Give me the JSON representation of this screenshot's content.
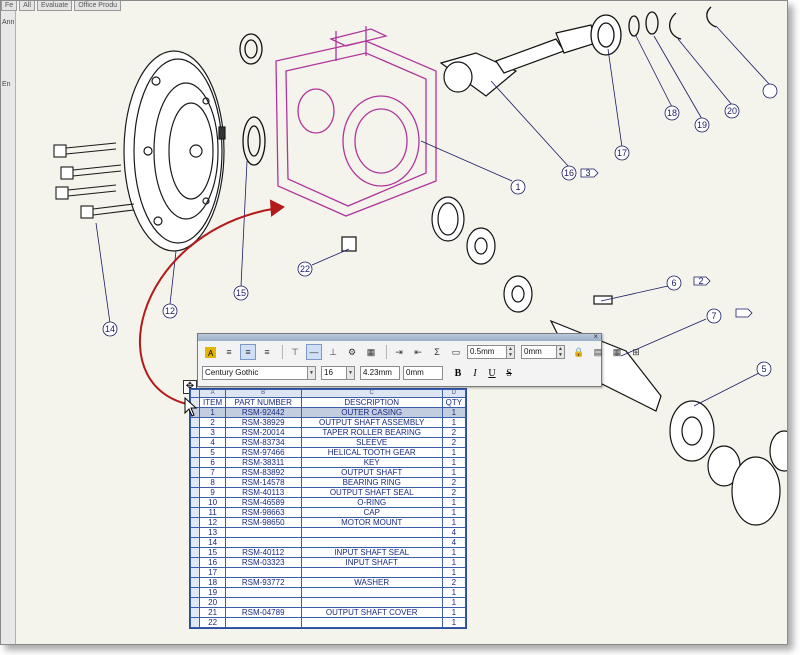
{
  "tabs": [
    "Fe",
    "All",
    "Evaluate",
    "Office Produ"
  ],
  "left_panel": {
    "labels": [
      "Ann",
      "En"
    ]
  },
  "callouts": [
    "1",
    "2",
    "3",
    "5",
    "6",
    "7",
    "12",
    "14",
    "15",
    "16",
    "17",
    "18",
    "19",
    "20",
    "22"
  ],
  "toolbar": {
    "font_name": "Century Gothic",
    "font_size": "16",
    "height_value": "4.23mm",
    "spacing_value": "0mm",
    "margin_value": "0.5mm",
    "margin2_value": "0mm",
    "bold": "B",
    "italic": "I",
    "underline": "U",
    "strike": "S",
    "sum_symbol": "Σ"
  },
  "bom": {
    "col_letters": [
      "A",
      "B",
      "C",
      "D"
    ],
    "headers": [
      "ITEM",
      "PART NUMBER",
      "DESCRIPTION",
      "QTY"
    ],
    "rows": [
      [
        "1",
        "RSM-92442",
        "OUTER CASING",
        "1"
      ],
      [
        "2",
        "RSM-38929",
        "OUTPUT SHAFT ASSEMBLY",
        "1"
      ],
      [
        "3",
        "RSM-20014",
        "TAPER ROLLER BEARING",
        "2"
      ],
      [
        "4",
        "RSM-83734",
        "SLEEVE",
        "2"
      ],
      [
        "5",
        "RSM-97466",
        "HELICAL TOOTH GEAR",
        "1"
      ],
      [
        "6",
        "RSM-38311",
        "KEY",
        "1"
      ],
      [
        "7",
        "RSM-83892",
        "OUTPUT SHAFT",
        "1"
      ],
      [
        "8",
        "RSM-14578",
        "BEARING RING",
        "2"
      ],
      [
        "9",
        "RSM-40113",
        "OUTPUT SHAFT SEAL",
        "2"
      ],
      [
        "10",
        "RSM-46589",
        "O-RING",
        "1"
      ],
      [
        "11",
        "RSM-98663",
        "CAP",
        "1"
      ],
      [
        "12",
        "RSM-98650",
        "MOTOR MOUNT",
        "1"
      ],
      [
        "13",
        "",
        "",
        "4"
      ],
      [
        "14",
        "",
        "",
        "4"
      ],
      [
        "15",
        "RSM-40112",
        "INPUT SHAFT SEAL",
        "1"
      ],
      [
        "16",
        "RSM-03323",
        "INPUT SHAFT",
        "1"
      ],
      [
        "17",
        "",
        "",
        "1"
      ],
      [
        "18",
        "RSM-93772",
        "WASHER",
        "2"
      ],
      [
        "19",
        "",
        "",
        "1"
      ],
      [
        "20",
        "",
        "",
        "1"
      ],
      [
        "21",
        "RSM-04789",
        "OUTPUT SHAFT COVER",
        "1"
      ],
      [
        "22",
        "",
        "",
        "1"
      ]
    ]
  },
  "colors": {
    "highlight_part": "#b0359c",
    "table_line": "#3b5ea8",
    "arrow": "#b31a1a",
    "callout": "#1a1a66"
  }
}
